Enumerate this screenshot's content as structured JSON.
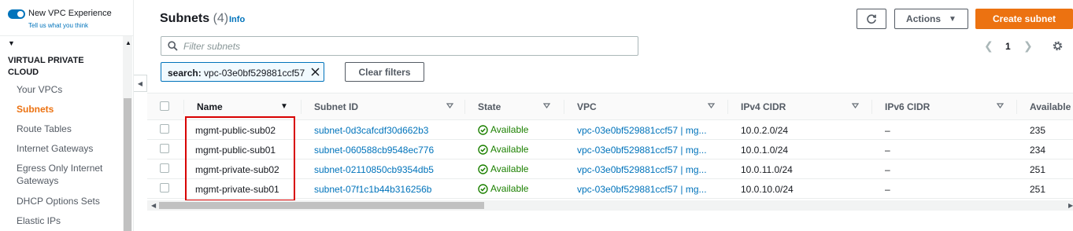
{
  "sidebar": {
    "new_vpc_experience": "New VPC Experience",
    "tell_us": "Tell us what you think",
    "section_title": "VIRTUAL PRIVATE CLOUD",
    "items": [
      {
        "label": "Your VPCs"
      },
      {
        "label": "Subnets"
      },
      {
        "label": "Route Tables"
      },
      {
        "label": "Internet Gateways"
      },
      {
        "label": "Egress Only Internet Gateways"
      },
      {
        "label": "DHCP Options Sets"
      },
      {
        "label": "Elastic IPs"
      }
    ],
    "active_index": 1
  },
  "header": {
    "title": "Subnets",
    "count": "(4)",
    "info": "Info",
    "actions_label": "Actions",
    "create_label": "Create subnet"
  },
  "filter": {
    "placeholder": "Filter subnets",
    "value": "",
    "token_key": "search:",
    "token_value": "vpc-03e0bf529881ccf57",
    "clear_label": "Clear filters"
  },
  "pagination": {
    "page": "1"
  },
  "table": {
    "columns": [
      "Name",
      "Subnet ID",
      "State",
      "VPC",
      "IPv4 CIDR",
      "IPv6 CIDR",
      "Available I"
    ],
    "rows": [
      {
        "name": "mgmt-public-sub02",
        "subnet_id": "subnet-0d3cafcdf30d662b3",
        "state": "Available",
        "vpc": "vpc-03e0bf529881ccf57 | mg...",
        "ipv4": "10.0.2.0/24",
        "ipv6": "–",
        "available": "235"
      },
      {
        "name": "mgmt-public-sub01",
        "subnet_id": "subnet-060588cb9548ec776",
        "state": "Available",
        "vpc": "vpc-03e0bf529881ccf57 | mg...",
        "ipv4": "10.0.1.0/24",
        "ipv6": "–",
        "available": "234"
      },
      {
        "name": "mgmt-private-sub02",
        "subnet_id": "subnet-02110850cb9354db5",
        "state": "Available",
        "vpc": "vpc-03e0bf529881ccf57 | mg...",
        "ipv4": "10.0.11.0/24",
        "ipv6": "–",
        "available": "251"
      },
      {
        "name": "mgmt-private-sub01",
        "subnet_id": "subnet-07f1c1b44b316256b",
        "state": "Available",
        "vpc": "vpc-03e0bf529881ccf57 | mg...",
        "ipv4": "10.0.10.0/24",
        "ipv6": "–",
        "available": "251"
      }
    ]
  },
  "colors": {
    "accent": "#ec7211",
    "link": "#0073bb",
    "available": "#1d8102",
    "highlight": "#d80000"
  }
}
